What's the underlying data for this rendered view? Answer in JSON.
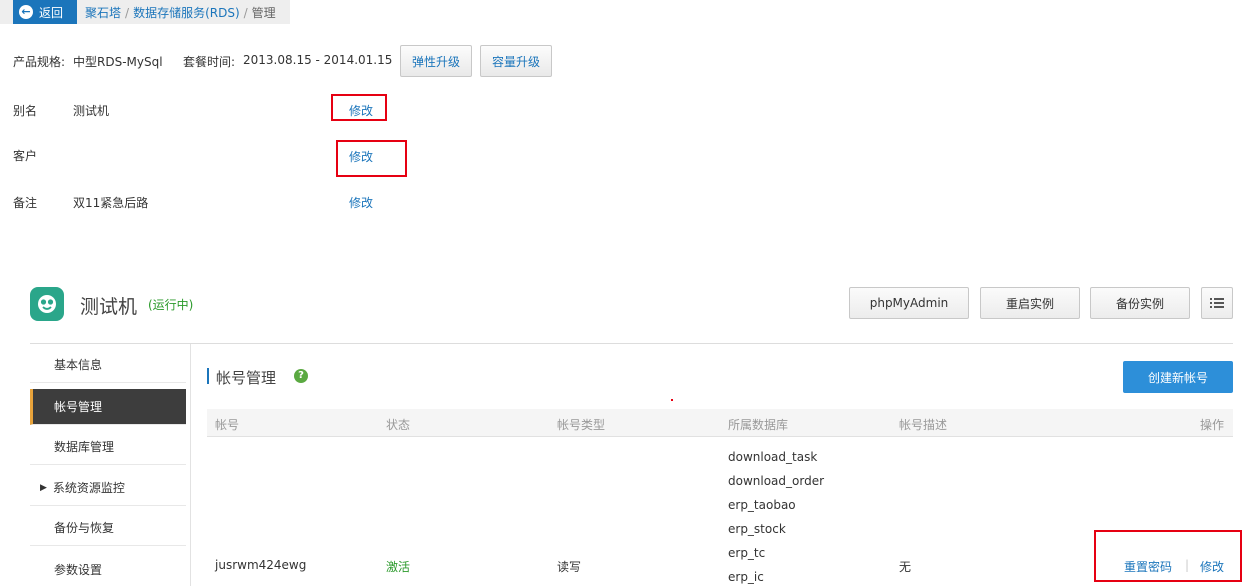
{
  "breadcrumb": {
    "back_label": "返回",
    "items": [
      "聚石塔",
      "数据存储服务(RDS)"
    ],
    "separator": "/",
    "current": "管理"
  },
  "product": {
    "spec_label": "产品规格:",
    "spec_value": "中型RDS-MySql",
    "period_label": "套餐时间:",
    "period_value": "2013.08.15 - 2014.01.15",
    "btn_upgrade": "弹性升级",
    "btn_capacity": "容量升级"
  },
  "info": {
    "alias_label": "别名",
    "alias_value": "测试机",
    "customer_label": "客户",
    "customer_value": "",
    "remark_label": "备注",
    "remark_value": "双11紧急后路",
    "edit_label": "修改"
  },
  "instance": {
    "name": "测试机",
    "status": "(运行中)",
    "btn_phpmyadmin": "phpMyAdmin",
    "btn_restart": "重启实例",
    "btn_backup": "备份实例"
  },
  "sidebar": {
    "items": [
      {
        "label": "基本信息"
      },
      {
        "label": "帐号管理"
      },
      {
        "label": "数据库管理"
      },
      {
        "label": "系统资源监控"
      },
      {
        "label": "备份与恢复"
      },
      {
        "label": "参数设置"
      }
    ]
  },
  "account": {
    "title": "帐号管理",
    "create_btn": "创建新帐号",
    "columns": [
      "帐号",
      "状态",
      "帐号类型",
      "所属数据库",
      "帐号描述",
      "操作"
    ],
    "row": {
      "account": "jusrwm424ewg",
      "status": "激活",
      "type": "读写",
      "databases": [
        "download_task",
        "download_order",
        "erp_taobao",
        "erp_stock",
        "erp_tc",
        "erp_ic"
      ],
      "description": "无",
      "reset_pwd": "重置密码",
      "action_sep": "|",
      "edit": "修改"
    }
  },
  "colors": {
    "link": "#1b75bb",
    "primary": "#2d8fd9",
    "active_sidebar": "#3d3d3d",
    "running": "#2b9a2b",
    "highlight_box": "#e60012"
  }
}
